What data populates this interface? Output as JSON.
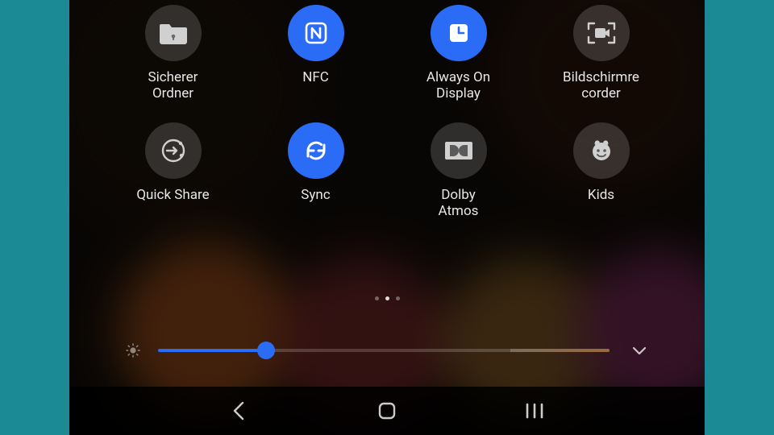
{
  "quick_settings": {
    "tiles": [
      {
        "id": "secure-folder",
        "label": "Sicherer\nOrdner",
        "active": false,
        "icon": "folder-lock-icon"
      },
      {
        "id": "nfc",
        "label": "NFC",
        "active": true,
        "icon": "nfc-icon"
      },
      {
        "id": "aod",
        "label": "Always On\nDisplay",
        "active": true,
        "icon": "clock-square-icon"
      },
      {
        "id": "screen-recorder",
        "label": "Bildschirmre\ncorder",
        "active": false,
        "icon": "screen-record-icon"
      },
      {
        "id": "quick-share",
        "label": "Quick Share",
        "active": false,
        "icon": "quick-share-icon"
      },
      {
        "id": "sync",
        "label": "Sync",
        "active": true,
        "icon": "sync-icon"
      },
      {
        "id": "dolby",
        "label": "Dolby\nAtmos",
        "active": false,
        "icon": "dolby-icon"
      },
      {
        "id": "kids",
        "label": "Kids",
        "active": false,
        "icon": "kids-icon"
      }
    ],
    "pager": {
      "pages": 3,
      "current": 2
    },
    "brightness": {
      "percent": 24
    },
    "colors": {
      "accent": "#2b6cf6",
      "tile_off": "rgba(255,255,255,.16)"
    }
  }
}
